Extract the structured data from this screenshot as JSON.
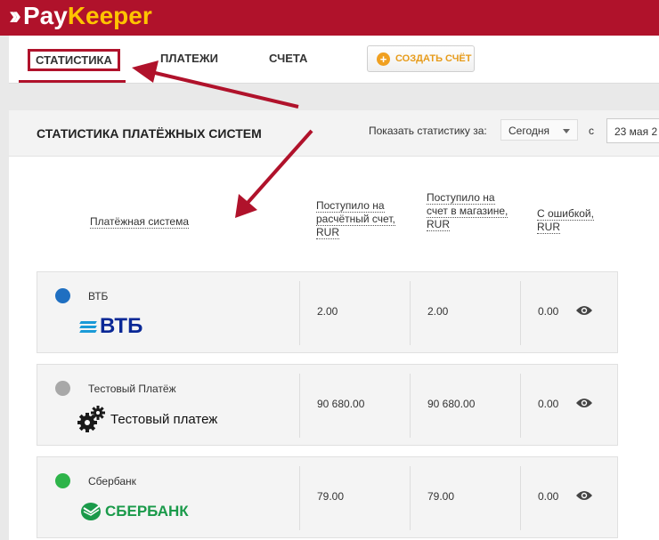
{
  "brand": {
    "part1": "Pay",
    "part2": "Keeper"
  },
  "nav": {
    "statistics": "Статистика",
    "payments": "Платежи",
    "invoices": "Счета",
    "create_invoice": "Создать счёт"
  },
  "panel": {
    "title": "Статистика платёжных систем",
    "show_label": "Показать статистику за:",
    "period": "Сегодня",
    "from_label": "с",
    "date_from": "23 мая 2"
  },
  "table": {
    "headers": {
      "system": "Платёжная система",
      "received_account": "Поступило на расчётный счет, RUR",
      "received_shop": "Поступило на счет в магазине, RUR",
      "with_error": "С ошибкой, RUR"
    },
    "rows": [
      {
        "name": "ВТБ",
        "status_color": "#1f6fc1",
        "logo_text": "ВТБ",
        "received_account": "2.00",
        "received_shop": "2.00",
        "with_error": "0.00",
        "icon": "eye-icon"
      },
      {
        "name": "Тестовый Платёж",
        "status_color": "#a8a8a8",
        "logo_text": "Тестовый платеж",
        "received_account": "90 680.00",
        "received_shop": "90 680.00",
        "with_error": "0.00",
        "icon": "eye-icon"
      },
      {
        "name": "Сбербанк",
        "status_color": "#2eb44a",
        "logo_text": "СБЕРБАНК",
        "received_account": "79.00",
        "received_shop": "79.00",
        "with_error": "0.00",
        "icon": "eye-icon"
      }
    ]
  },
  "colors": {
    "brand_red": "#b0122b",
    "brand_yellow": "#ffc400",
    "annotation_arrow": "#b0122b"
  }
}
